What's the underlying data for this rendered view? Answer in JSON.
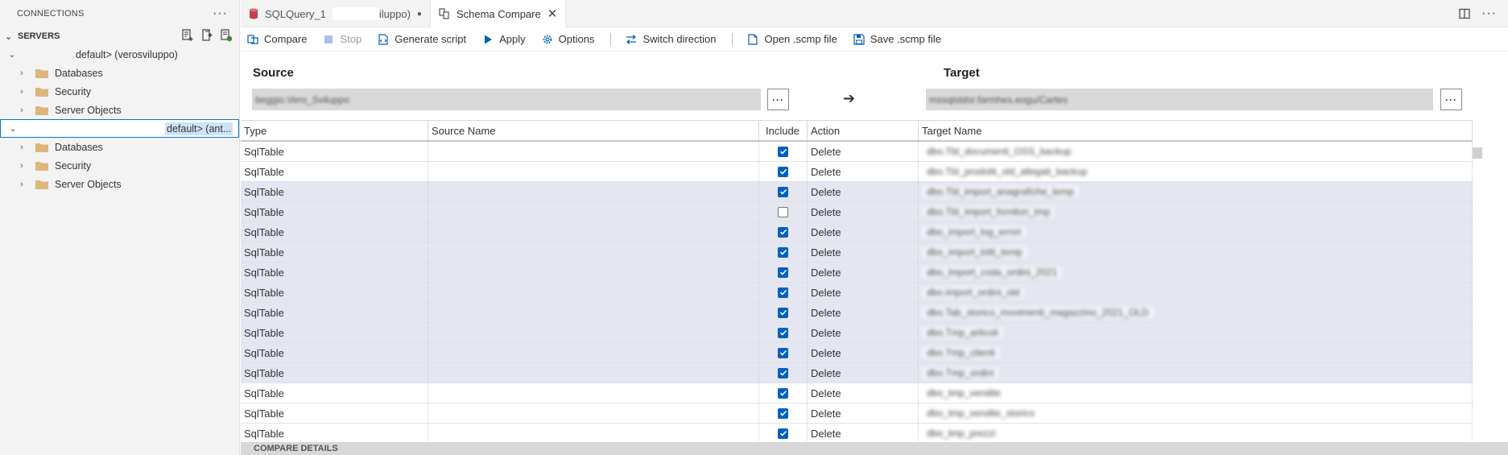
{
  "sidebar": {
    "title": "CONNECTIONS",
    "more": "···",
    "servers_label": "SERVERS",
    "servers": [
      {
        "label": "default> (verosviluppo)",
        "expanded": true,
        "selected": false,
        "children": [
          "Databases",
          "Security",
          "Server Objects"
        ]
      },
      {
        "label": "default> (ant...",
        "expanded": true,
        "selected": true,
        "children": [
          "Databases",
          "Security",
          "Server Objects"
        ]
      }
    ]
  },
  "tabs": [
    {
      "label_start": "SQLQuery_1",
      "label_end": "iluppo)",
      "dirty": "●",
      "active": false,
      "icon": "database-icon"
    },
    {
      "label": "Schema Compare",
      "close": "✕",
      "active": true,
      "icon": "schema-compare-icon"
    }
  ],
  "toolbar": {
    "compare": "Compare",
    "stop": "Stop",
    "generate_script": "Generate script",
    "apply": "Apply",
    "options": "Options",
    "switch_direction": "Switch direction",
    "open_scmp": "Open .scmp file",
    "save_scmp": "Save .scmp file"
  },
  "source": {
    "title": "Source",
    "path": "beggio.Vero_Sviluppo",
    "more": "···"
  },
  "target": {
    "title": "Target",
    "path": "mssqlstdsr.farmhes.eogu/Cartes",
    "more": "···"
  },
  "direction_arrow": "➔",
  "table": {
    "headers": [
      "Type",
      "Source Name",
      "Include",
      "Action",
      "Target Name"
    ],
    "rows": [
      {
        "type": "SqlTable",
        "source": "",
        "include": true,
        "action": "Delete",
        "target": "dbo.Tbl_documenti_OSS_backup",
        "highlight": false
      },
      {
        "type": "SqlTable",
        "source": "",
        "include": true,
        "action": "Delete",
        "target": "dbo.Tbl_prodotti_old_allegati_backup",
        "highlight": false
      },
      {
        "type": "SqlTable",
        "source": "",
        "include": true,
        "action": "Delete",
        "target": "dbo.Tbl_import_anagrafiche_temp",
        "highlight": true
      },
      {
        "type": "SqlTable",
        "source": "",
        "include": false,
        "action": "Delete",
        "target": "dbo.Tbl_import_fornitori_tmp",
        "highlight": true
      },
      {
        "type": "SqlTable",
        "source": "",
        "include": true,
        "action": "Delete",
        "target": "dbo_import_log_errori",
        "highlight": true
      },
      {
        "type": "SqlTable",
        "source": "",
        "include": true,
        "action": "Delete",
        "target": "dbo_import_lotti_temp",
        "highlight": true
      },
      {
        "type": "SqlTable",
        "source": "",
        "include": true,
        "action": "Delete",
        "target": "dbo_import_coda_ordini_2021",
        "highlight": true
      },
      {
        "type": "SqlTable",
        "source": "",
        "include": true,
        "action": "Delete",
        "target": "dbo.import_ordini_old",
        "highlight": true
      },
      {
        "type": "SqlTable",
        "source": "",
        "include": true,
        "action": "Delete",
        "target": "dbo.Tab_storico_movimenti_magazzino_2021_OLD",
        "highlight": true
      },
      {
        "type": "SqlTable",
        "source": "",
        "include": true,
        "action": "Delete",
        "target": "dbo.Tmp_articoli",
        "highlight": true
      },
      {
        "type": "SqlTable",
        "source": "",
        "include": true,
        "action": "Delete",
        "target": "dbo.Tmp_clienti",
        "highlight": true
      },
      {
        "type": "SqlTable",
        "source": "",
        "include": true,
        "action": "Delete",
        "target": "dbo.Tmp_ordini",
        "highlight": true
      },
      {
        "type": "SqlTable",
        "source": "",
        "include": true,
        "action": "Delete",
        "target": "dbo_tmp_vendite",
        "highlight": false
      },
      {
        "type": "SqlTable",
        "source": "",
        "include": true,
        "action": "Delete",
        "target": "dbo_tmp_vendite_storico",
        "highlight": false
      },
      {
        "type": "SqlTable",
        "source": "",
        "include": true,
        "action": "Delete",
        "target": "dbo_tmp_prezzi",
        "highlight": false
      }
    ]
  },
  "details": {
    "title": "COMPARE DETAILS"
  }
}
